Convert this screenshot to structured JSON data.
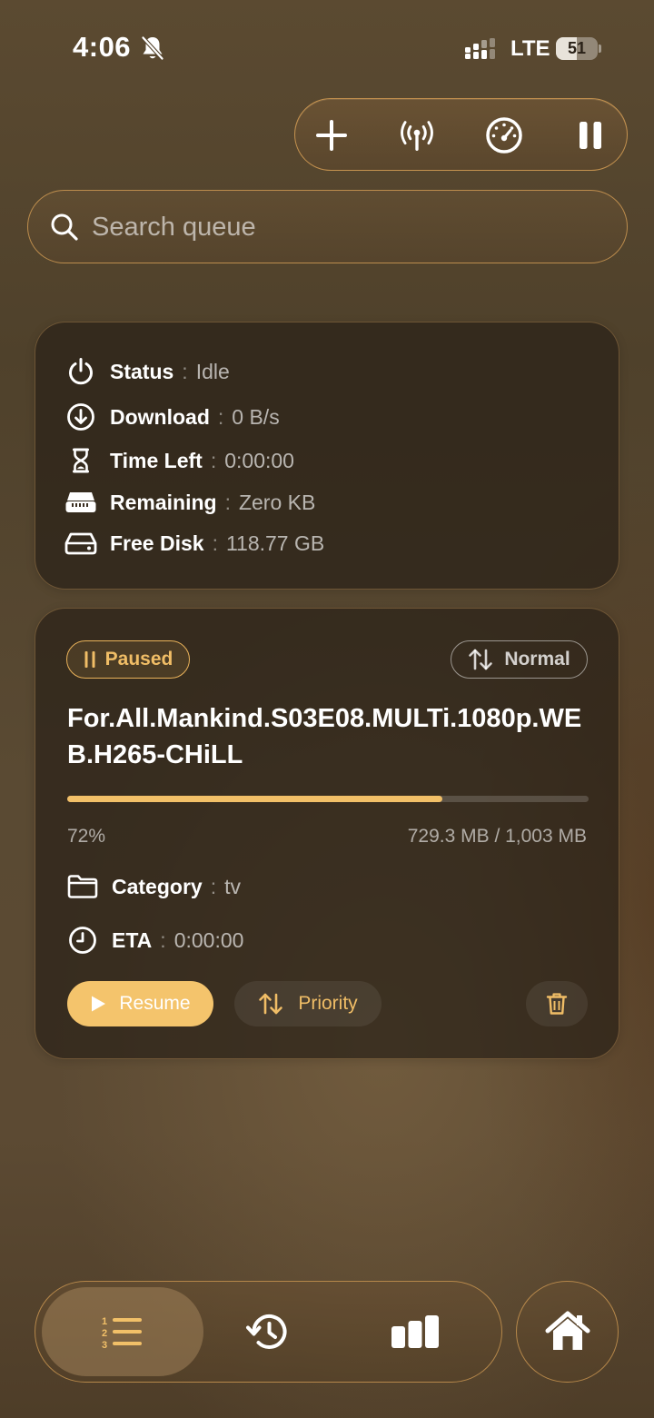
{
  "status_bar": {
    "time": "4:06",
    "network": "LTE",
    "battery_level": "51",
    "battery_fraction": 0.51,
    "icons": [
      "bell-slash-icon",
      "signal-icon",
      "battery-icon"
    ]
  },
  "toolbar": {
    "buttons": [
      "plus-icon",
      "broadcast-icon",
      "speedometer-icon",
      "pause-icon"
    ]
  },
  "search": {
    "placeholder": "Search queue"
  },
  "stats": {
    "status_label": "Status",
    "status_value": "Idle",
    "download_label": "Download",
    "download_value": "0 B/s",
    "time_left_label": "Time Left",
    "time_left_value": "0:00:00",
    "remaining_label": "Remaining",
    "remaining_value": "Zero KB",
    "free_disk_label": "Free Disk",
    "free_disk_value": "118.77 GB",
    "separator": ":"
  },
  "job": {
    "state_badge": "Paused",
    "priority_badge": "Normal",
    "title": "For.All.Mankind.S03E08.MULTi.1080p.WEB.H265-CHiLL",
    "progress_percent": 72,
    "progress_label": "72%",
    "size_label": "729.3 MB / 1,003 MB",
    "category_label": "Category",
    "category_value": "tv",
    "eta_label": "ETA",
    "eta_value": "0:00:00",
    "resume_label": "Resume",
    "priority_label": "Priority"
  },
  "tabbar": {
    "tabs": [
      "queue-list-icon",
      "history-icon",
      "stats-icon"
    ],
    "active_tab": "queue-list-icon",
    "home": "home-icon"
  },
  "colors": {
    "accent": "#f4c46c",
    "accent_border": "#e9b25a",
    "card_bg": "#2a2117",
    "background": "#56462f"
  }
}
